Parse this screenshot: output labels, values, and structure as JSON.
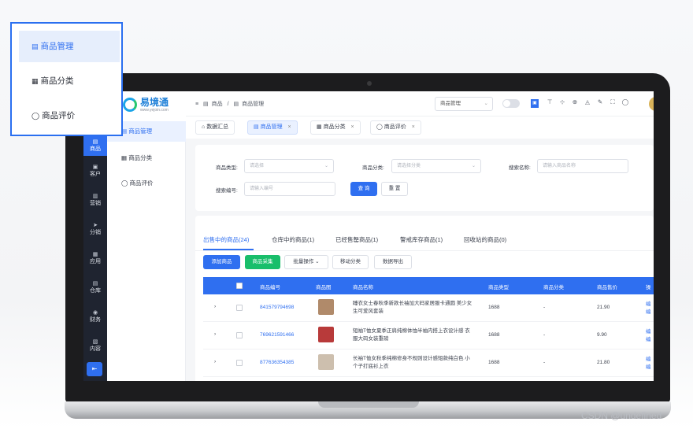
{
  "callout": {
    "items": [
      {
        "label": "商品管理",
        "icon": "▤"
      },
      {
        "label": "商品分类",
        "icon": "▦"
      },
      {
        "label": "商品评价",
        "icon": "◯"
      }
    ]
  },
  "brand": {
    "name": "易境通",
    "url": "www.yejoin.com"
  },
  "rail": {
    "items": [
      {
        "label": "商品",
        "icon": "▤"
      },
      {
        "label": "客户",
        "icon": "▣"
      },
      {
        "label": "营销",
        "icon": "▥"
      },
      {
        "label": "分销",
        "icon": "➤"
      },
      {
        "label": "应用",
        "icon": "▦"
      },
      {
        "label": "仓库",
        "icon": "▤"
      },
      {
        "label": "财务",
        "icon": "◉"
      },
      {
        "label": "内容",
        "icon": "▧"
      }
    ],
    "collapse_icon": "⇤"
  },
  "sidebar": {
    "items": [
      {
        "label": "商品管理",
        "icon": "▤"
      },
      {
        "label": "商品分类",
        "icon": "▦"
      },
      {
        "label": "商品评价",
        "icon": "◯"
      }
    ]
  },
  "topbar": {
    "menu_icon": "≡",
    "crumb_root_icon": "▤",
    "crumb_root": "商品",
    "crumb_sep": "/",
    "crumb_current_icon": "▤",
    "crumb_current": "商品管理",
    "select_value": "商品管理",
    "select_arrow": "⌄",
    "icons": [
      "◫",
      "⊤",
      "⊹",
      "⊕",
      "◬",
      "✎",
      "⛶",
      "◯"
    ],
    "blue_icon": "▣"
  },
  "tabs": [
    {
      "label": "数据汇总",
      "icon": "⌂",
      "closable": false
    },
    {
      "label": "商品管理",
      "icon": "▤",
      "closable": true
    },
    {
      "label": "商品分类",
      "icon": "▦",
      "closable": true
    },
    {
      "label": "商品评价",
      "icon": "◯",
      "closable": true
    }
  ],
  "tab_close": "×",
  "search": {
    "type_label": "商品类型:",
    "type_placeholder": "请选择",
    "cat_label": "商品分类:",
    "cat_placeholder": "请选择分类",
    "name_label": "搜索名称:",
    "name_placeholder": "请输入商品名称",
    "code_label": "搜索编号:",
    "code_placeholder": "请输入编号",
    "query_btn": "查 询",
    "reset_btn": "重 置",
    "arrow": "⌄"
  },
  "subtabs": [
    {
      "label": "出售中的商品(24)"
    },
    {
      "label": "仓库中的商品(1)"
    },
    {
      "label": "已经售罄商品(1)"
    },
    {
      "label": "警戒库存商品(1)"
    },
    {
      "label": "回收站的商品(0)"
    }
  ],
  "actions": {
    "add": "添加商品",
    "collect": "商品采集",
    "batch": "批量操作",
    "batch_arrow": "⌄",
    "move": "移动分类",
    "export": "数据导出"
  },
  "table": {
    "headers": [
      "商品编号",
      "商品图",
      "商品名称",
      "商品类型",
      "商品分类",
      "商品售价",
      "操"
    ],
    "rows": [
      {
        "expand": "›",
        "code": "841579794698",
        "name": "睡衣女士春秋季新款长袖加大码家居服卡通圆 美少女生可爱风套装",
        "type": "1688",
        "category": "-",
        "price": "21.90",
        "op": "编 编",
        "thumb_color": "#b08a6a"
      },
      {
        "expand": "›",
        "code": "769621591466",
        "name": "短袖T恤女夏季正肩纯棉体恤半袖内搭上衣设计感 衣服大码女装重磅",
        "type": "1688",
        "category": "-",
        "price": "9.90",
        "op": "编 编",
        "thumb_color": "#b83a3a"
      },
      {
        "expand": "›",
        "code": "877636354385",
        "name": "长袖T恤女秋季纯棉修身不规则设计感短款纯白色 小个子打底衫上衣",
        "type": "1688",
        "category": "-",
        "price": "21.80",
        "op": "编 编",
        "thumb_color": "#cdbfae"
      }
    ]
  },
  "watermark": "CSDN @undefined"
}
